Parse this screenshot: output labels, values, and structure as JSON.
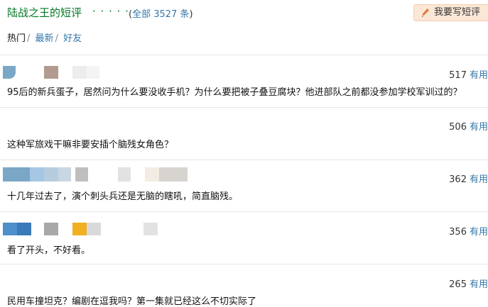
{
  "header": {
    "title": "陆战之王的短评",
    "dots": "· · · · · ·",
    "count_open": "(",
    "count_link": "全部 3527 条",
    "count_close": ")",
    "write_label": "我要写短评"
  },
  "tabs": [
    {
      "label": "热门"
    },
    {
      "label": "最新"
    },
    {
      "label": "好友"
    }
  ],
  "tab_sep": "/",
  "useful_label": "有用",
  "reviews": [
    {
      "votes": "517",
      "text": "95后的新兵蛋子，居然问为什么要没收手机？为什么要把被子叠豆腐块？他进部队之前都没参加学校军训过的？"
    },
    {
      "votes": "506",
      "text": "这种军旅戏干嘛非要安插个脑残女角色？"
    },
    {
      "votes": "362",
      "text": "十几年过去了，演个刺头兵还是无脑的瞎吼，简直脑残。"
    },
    {
      "votes": "356",
      "text": "看了开头，不好看。"
    },
    {
      "votes": "265",
      "text": "民用车撞坦克？编剧在逗我吗？第一集就已经这么不切实际了"
    }
  ],
  "colors": {
    "accent_green": "#007722",
    "link_blue": "#3377aa",
    "button_bg": "#fbe7d6"
  },
  "icons": {
    "write": "pencil-icon"
  }
}
